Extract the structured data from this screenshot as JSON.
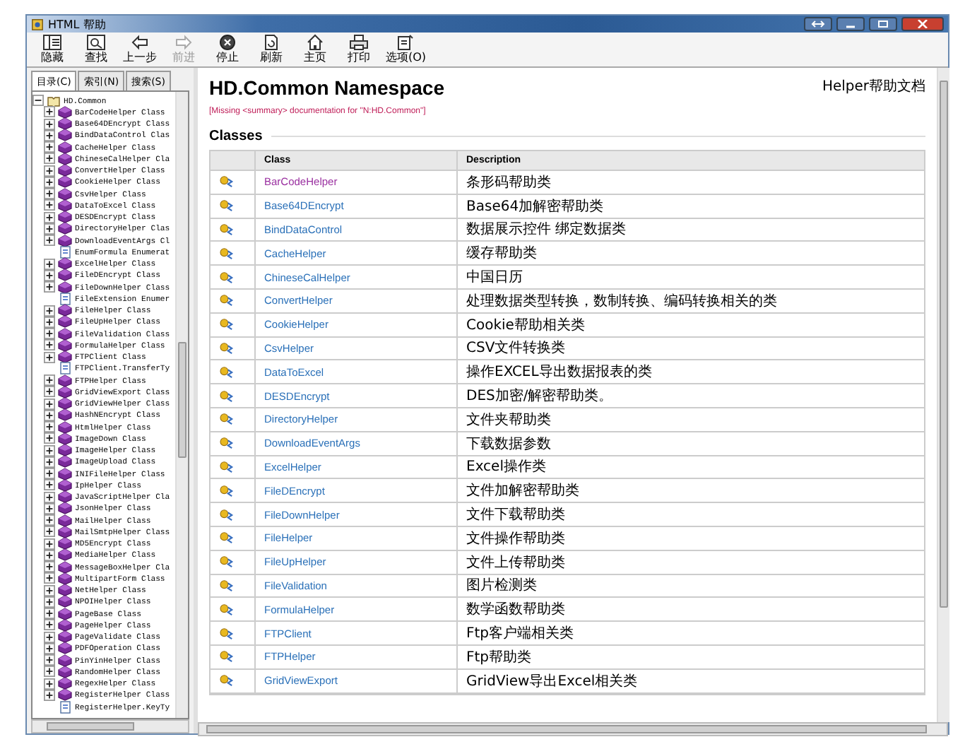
{
  "window": {
    "title": "HTML 帮助"
  },
  "toolbar": [
    {
      "label": "隐藏",
      "kind": "hide",
      "disabled": false
    },
    {
      "label": "查找",
      "kind": "find",
      "disabled": false
    },
    {
      "label": "上一步",
      "kind": "back",
      "disabled": false
    },
    {
      "label": "前进",
      "kind": "forward",
      "disabled": true
    },
    {
      "label": "停止",
      "kind": "stop",
      "disabled": false
    },
    {
      "label": "刷新",
      "kind": "refresh",
      "disabled": false
    },
    {
      "label": "主页",
      "kind": "home",
      "disabled": false
    },
    {
      "label": "打印",
      "kind": "print",
      "disabled": false
    },
    {
      "label": "选项(O)",
      "kind": "options",
      "disabled": false
    }
  ],
  "tabs": [
    {
      "label": "目录(C)",
      "selected": true
    },
    {
      "label": "索引(N)",
      "selected": false
    },
    {
      "label": "搜索(S)",
      "selected": false
    }
  ],
  "tree": [
    {
      "label": "HD.Common",
      "kind": "namespace",
      "expanded": true,
      "children": [
        {
          "label": "BarCodeHelper Class",
          "kind": "class",
          "expanded": false
        },
        {
          "label": "Base64DEncrypt Class",
          "kind": "class",
          "expanded": false
        },
        {
          "label": "BindDataControl Clas",
          "kind": "class",
          "expanded": false
        },
        {
          "label": "CacheHelper Class",
          "kind": "class",
          "expanded": false
        },
        {
          "label": "ChineseCalHelper Cla",
          "kind": "class",
          "expanded": false
        },
        {
          "label": "ConvertHelper Class",
          "kind": "class",
          "expanded": false
        },
        {
          "label": "CookieHelper Class",
          "kind": "class",
          "expanded": false
        },
        {
          "label": "CsvHelper Class",
          "kind": "class",
          "expanded": false
        },
        {
          "label": "DataToExcel Class",
          "kind": "class",
          "expanded": false
        },
        {
          "label": "DESDEncrypt Class",
          "kind": "class",
          "expanded": false
        },
        {
          "label": "DirectoryHelper Clas",
          "kind": "class",
          "expanded": false
        },
        {
          "label": "DownloadEventArgs Cl",
          "kind": "class",
          "expanded": false
        },
        {
          "label": "EnumFormula Enumerat",
          "kind": "enum"
        },
        {
          "label": "ExcelHelper Class",
          "kind": "class",
          "expanded": false
        },
        {
          "label": "FileDEncrypt Class",
          "kind": "class",
          "expanded": false
        },
        {
          "label": "FileDownHelper Class",
          "kind": "class",
          "expanded": false
        },
        {
          "label": "FileExtension Enumer",
          "kind": "enum"
        },
        {
          "label": "FileHelper Class",
          "kind": "class",
          "expanded": false
        },
        {
          "label": "FileUpHelper Class",
          "kind": "class",
          "expanded": false
        },
        {
          "label": "FileValidation Class",
          "kind": "class",
          "expanded": false
        },
        {
          "label": "FormulaHelper Class",
          "kind": "class",
          "expanded": false
        },
        {
          "label": "FTPClient Class",
          "kind": "class",
          "expanded": false
        },
        {
          "label": "FTPClient.TransferTy",
          "kind": "enum"
        },
        {
          "label": "FTPHelper Class",
          "kind": "class",
          "expanded": false
        },
        {
          "label": "GridViewExport Class",
          "kind": "class",
          "expanded": false
        },
        {
          "label": "GridViewHelper Class",
          "kind": "class",
          "expanded": false
        },
        {
          "label": "HashNEncrypt Class",
          "kind": "class",
          "expanded": false
        },
        {
          "label": "HtmlHelper Class",
          "kind": "class",
          "expanded": false
        },
        {
          "label": "ImageDown Class",
          "kind": "class",
          "expanded": false
        },
        {
          "label": "ImageHelper Class",
          "kind": "class",
          "expanded": false
        },
        {
          "label": "ImageUpload Class",
          "kind": "class",
          "expanded": false
        },
        {
          "label": "INIFileHelper Class",
          "kind": "class",
          "expanded": false
        },
        {
          "label": "IpHelper Class",
          "kind": "class",
          "expanded": false
        },
        {
          "label": "JavaScriptHelper Cla",
          "kind": "class",
          "expanded": false
        },
        {
          "label": "JsonHelper Class",
          "kind": "class",
          "expanded": false
        },
        {
          "label": "MailHelper Class",
          "kind": "class",
          "expanded": false
        },
        {
          "label": "MailSmtpHelper Class",
          "kind": "class",
          "expanded": false
        },
        {
          "label": "MD5Encrypt Class",
          "kind": "class",
          "expanded": false
        },
        {
          "label": "MediaHelper Class",
          "kind": "class",
          "expanded": false
        },
        {
          "label": "MessageBoxHelper Cla",
          "kind": "class",
          "expanded": false
        },
        {
          "label": "MultipartForm Class",
          "kind": "class",
          "expanded": false
        },
        {
          "label": "NetHelper Class",
          "kind": "class",
          "expanded": false
        },
        {
          "label": "NPOIHelper Class",
          "kind": "class",
          "expanded": false
        },
        {
          "label": "PageBase Class",
          "kind": "class",
          "expanded": false
        },
        {
          "label": "PageHelper Class",
          "kind": "class",
          "expanded": false
        },
        {
          "label": "PageValidate Class",
          "kind": "class",
          "expanded": false
        },
        {
          "label": "PDFOperation Class",
          "kind": "class",
          "expanded": false
        },
        {
          "label": "PinYinHelper Class",
          "kind": "class",
          "expanded": false
        },
        {
          "label": "RandomHelper Class",
          "kind": "class",
          "expanded": false
        },
        {
          "label": "RegexHelper Class",
          "kind": "class",
          "expanded": false
        },
        {
          "label": "RegisterHelper Class",
          "kind": "class",
          "expanded": false
        },
        {
          "label": "RegisterHelper.KeyTy",
          "kind": "enum"
        }
      ]
    }
  ],
  "page": {
    "title": "HD.Common Namespace",
    "header_right": "Helper帮助文档",
    "missing_note": "[Missing <summary> documentation for \"N:HD.Common\"]",
    "section": "Classes",
    "table": {
      "columns": [
        "Class",
        "Description"
      ],
      "rows": [
        {
          "class": "BarCodeHelper",
          "description": "条形码帮助类",
          "visited": true
        },
        {
          "class": "Base64DEncrypt",
          "description": "Base64加解密帮助类",
          "visited": false
        },
        {
          "class": "BindDataControl",
          "description": "数据展示控件 绑定数据类",
          "visited": false
        },
        {
          "class": "CacheHelper",
          "description": "缓存帮助类",
          "visited": false
        },
        {
          "class": "ChineseCalHelper",
          "description": "中国日历",
          "visited": false
        },
        {
          "class": "ConvertHelper",
          "description": "处理数据类型转换，数制转换、编码转换相关的类",
          "visited": false
        },
        {
          "class": "CookieHelper",
          "description": "Cookie帮助相关类",
          "visited": false
        },
        {
          "class": "CsvHelper",
          "description": "CSV文件转换类",
          "visited": false
        },
        {
          "class": "DataToExcel",
          "description": "操作EXCEL导出数据报表的类",
          "visited": false
        },
        {
          "class": "DESDEncrypt",
          "description": "DES加密/解密帮助类。",
          "visited": false
        },
        {
          "class": "DirectoryHelper",
          "description": "文件夹帮助类",
          "visited": false
        },
        {
          "class": "DownloadEventArgs",
          "description": "下载数据参数",
          "visited": false
        },
        {
          "class": "ExcelHelper",
          "description": "Excel操作类",
          "visited": false
        },
        {
          "class": "FileDEncrypt",
          "description": "文件加解密帮助类",
          "visited": false
        },
        {
          "class": "FileDownHelper",
          "description": "文件下载帮助类",
          "visited": false
        },
        {
          "class": "FileHelper",
          "description": "文件操作帮助类",
          "visited": false
        },
        {
          "class": "FileUpHelper",
          "description": "文件上传帮助类",
          "visited": false
        },
        {
          "class": "FileValidation",
          "description": "图片检测类",
          "visited": false
        },
        {
          "class": "FormulaHelper",
          "description": "数学函数帮助类",
          "visited": false
        },
        {
          "class": "FTPClient",
          "description": "Ftp客户端相关类",
          "visited": false
        },
        {
          "class": "FTPHelper",
          "description": "Ftp帮助类",
          "visited": false
        },
        {
          "class": "GridViewExport",
          "description": "GridView导出Excel相关类",
          "visited": false
        }
      ]
    }
  }
}
